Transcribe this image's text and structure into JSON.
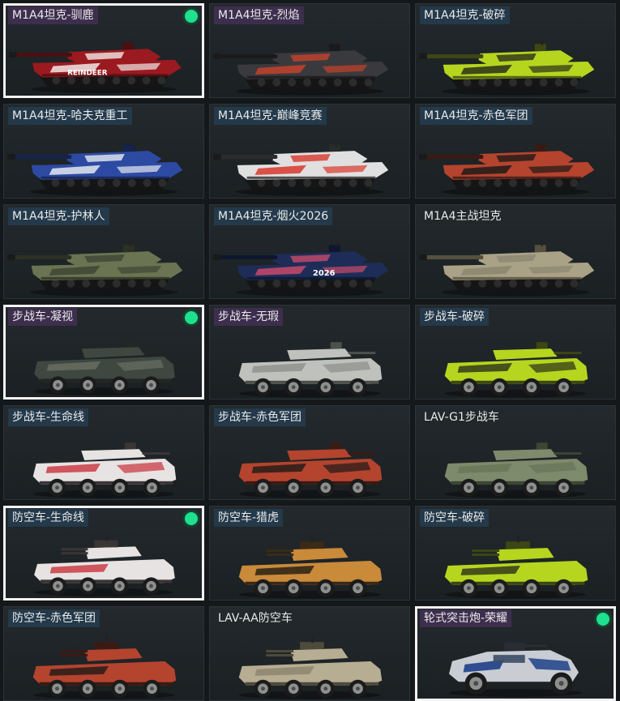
{
  "items": [
    {
      "label": "M1A4坦克-驯鹿",
      "kind": "tank",
      "tag": "purple",
      "equipped": true,
      "selected": true,
      "hull": "#9b1a1f",
      "stripe": "#f1e8e6",
      "dark": "#4a0f12",
      "text": "REINDEER"
    },
    {
      "label": "M1A4坦克-烈焰",
      "kind": "tank",
      "tag": "purple",
      "equipped": false,
      "selected": false,
      "hull": "#3a3a3e",
      "stripe": "#c6422a",
      "dark": "#1a1a1c",
      "text": ""
    },
    {
      "label": "M1A4坦克-破碎",
      "kind": "tank",
      "tag": "blue",
      "equipped": false,
      "selected": false,
      "hull": "#b6d51f",
      "stripe": "#2a2f1a",
      "dark": "#3d4614",
      "text": ""
    },
    {
      "label": "M1A4坦克-哈夫克重工",
      "kind": "tank",
      "tag": "blue",
      "equipped": false,
      "selected": false,
      "hull": "#2d4aa3",
      "stripe": "#e5e8ef",
      "dark": "#15234d",
      "text": ""
    },
    {
      "label": "M1A4坦克-巅峰竞赛",
      "kind": "tank",
      "tag": "blue",
      "equipped": false,
      "selected": false,
      "hull": "#e0e0e0",
      "stripe": "#d8372c",
      "dark": "#2b2b2b",
      "text": ""
    },
    {
      "label": "M1A4坦克-赤色军团",
      "kind": "tank",
      "tag": "blue",
      "equipped": false,
      "selected": false,
      "hull": "#b4442e",
      "stripe": "#1f1a18",
      "dark": "#3a1a14",
      "text": ""
    },
    {
      "label": "M1A4坦克-护林人",
      "kind": "tank",
      "tag": "blue",
      "equipped": false,
      "selected": false,
      "hull": "#6b7452",
      "stripe": "#3e4634",
      "dark": "#2c3124",
      "text": ""
    },
    {
      "label": "M1A4坦克-烟火2026",
      "kind": "tank",
      "tag": "blue",
      "equipped": false,
      "selected": false,
      "hull": "#1d2d58",
      "stripe": "#c84a6a",
      "dark": "#0e1630",
      "text": "2026"
    },
    {
      "label": "M1A4主战坦克",
      "kind": "tank",
      "tag": "none",
      "equipped": false,
      "selected": false,
      "hull": "#a9a286",
      "stripe": "#8c8670",
      "dark": "#55503e",
      "text": ""
    },
    {
      "label": "步战车-凝视",
      "kind": "ifv",
      "tag": "purple",
      "equipped": true,
      "selected": true,
      "hull": "#3f4840",
      "stripe": "#6a6f62",
      "dark": "#222724",
      "text": ""
    },
    {
      "label": "步战车-无瑕",
      "kind": "ifv",
      "tag": "purple",
      "equipped": false,
      "selected": false,
      "hull": "#bfc1bc",
      "stripe": "#8c8f89",
      "dark": "#4d504b",
      "text": ""
    },
    {
      "label": "步战车-破碎",
      "kind": "ifv",
      "tag": "blue",
      "equipped": false,
      "selected": false,
      "hull": "#b6d51f",
      "stripe": "#2a2f1a",
      "dark": "#3d4614",
      "text": ""
    },
    {
      "label": "步战车-生命线",
      "kind": "ifv",
      "tag": "blue",
      "equipped": false,
      "selected": false,
      "hull": "#e7e3e3",
      "stripe": "#c8323a",
      "dark": "#3a3636",
      "text": ""
    },
    {
      "label": "步战车-赤色军团",
      "kind": "ifv",
      "tag": "blue",
      "equipped": false,
      "selected": false,
      "hull": "#b4442e",
      "stripe": "#1f1a18",
      "dark": "#3a1a14",
      "text": ""
    },
    {
      "label": "LAV-G1步战车",
      "kind": "ifv",
      "tag": "none",
      "equipped": false,
      "selected": false,
      "hull": "#7d8a6c",
      "stripe": "#687458",
      "dark": "#3d4533",
      "text": ""
    },
    {
      "label": "防空车-生命线",
      "kind": "aa",
      "tag": "blue",
      "equipped": true,
      "selected": true,
      "hull": "#e7e3e3",
      "stripe": "#c8323a",
      "dark": "#3a3636",
      "text": ""
    },
    {
      "label": "防空车-猎虎",
      "kind": "aa",
      "tag": "blue",
      "equipped": false,
      "selected": false,
      "hull": "#c98a3a",
      "stripe": "#1f1a14",
      "dark": "#3a2a16",
      "text": ""
    },
    {
      "label": "防空车-破碎",
      "kind": "aa",
      "tag": "blue",
      "equipped": false,
      "selected": false,
      "hull": "#b6d51f",
      "stripe": "#2a2f1a",
      "dark": "#3d4614",
      "text": ""
    },
    {
      "label": "防空车-赤色军团",
      "kind": "aa",
      "tag": "blue",
      "equipped": false,
      "selected": false,
      "hull": "#b4442e",
      "stripe": "#1f1a18",
      "dark": "#3a1a14",
      "text": ""
    },
    {
      "label": "LAV-AA防空车",
      "kind": "aa",
      "tag": "none",
      "equipped": false,
      "selected": false,
      "hull": "#b7ad92",
      "stripe": "#8a826c",
      "dark": "#4e4a3c",
      "text": ""
    },
    {
      "label": "轮式突击炮-荣耀",
      "kind": "buggy",
      "tag": "purple",
      "equipped": true,
      "selected": true,
      "hull": "#c9ccd2",
      "stripe": "#1f3f8a",
      "dark": "#2a2d33",
      "text": ""
    }
  ]
}
